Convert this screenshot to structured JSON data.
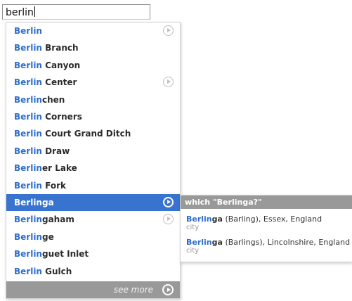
{
  "search": {
    "value": "berlin"
  },
  "suggestions": [
    {
      "match": "Berlin",
      "rest": "",
      "has_arrow": true
    },
    {
      "match": "Berlin",
      "rest": " Branch",
      "has_arrow": false
    },
    {
      "match": "Berlin",
      "rest": " Canyon",
      "has_arrow": false
    },
    {
      "match": "Berlin",
      "rest": " Center",
      "has_arrow": true
    },
    {
      "match": "Berlin",
      "rest": "chen",
      "has_arrow": false
    },
    {
      "match": "Berlin",
      "rest": " Corners",
      "has_arrow": false
    },
    {
      "match": "Berlin",
      "rest": " Court Grand Ditch",
      "has_arrow": false
    },
    {
      "match": "Berlin",
      "rest": " Draw",
      "has_arrow": false
    },
    {
      "match": "Berlin",
      "rest": "er Lake",
      "has_arrow": false
    },
    {
      "match": "Berlin",
      "rest": " Fork",
      "has_arrow": false
    },
    {
      "match": "Berlin",
      "rest": "ga",
      "has_arrow": true,
      "selected": true
    },
    {
      "match": "Berlin",
      "rest": "gaham",
      "has_arrow": true
    },
    {
      "match": "Berlin",
      "rest": "ge",
      "has_arrow": false
    },
    {
      "match": "Berlin",
      "rest": "guet Inlet",
      "has_arrow": false
    },
    {
      "match": "Berlin",
      "rest": " Gulch",
      "has_arrow": false
    }
  ],
  "see_more": {
    "label": "see more"
  },
  "flyout": {
    "header": "which \"Berlinga?\"",
    "results": [
      {
        "match": "Berlin",
        "rest_bold": "ga",
        "detail": " (Barling), Essex, England",
        "type": "city"
      },
      {
        "match": "Berlin",
        "rest_bold": "ga",
        "detail": " (Barlings), Lincolnshire, England",
        "type": "city"
      }
    ]
  },
  "colors": {
    "match_blue": "#2e6ecb",
    "selected_bg": "#3874cf",
    "footer_gray": "#999999"
  },
  "icons": {
    "row_arrow": "circled-play-arrow-icon"
  }
}
